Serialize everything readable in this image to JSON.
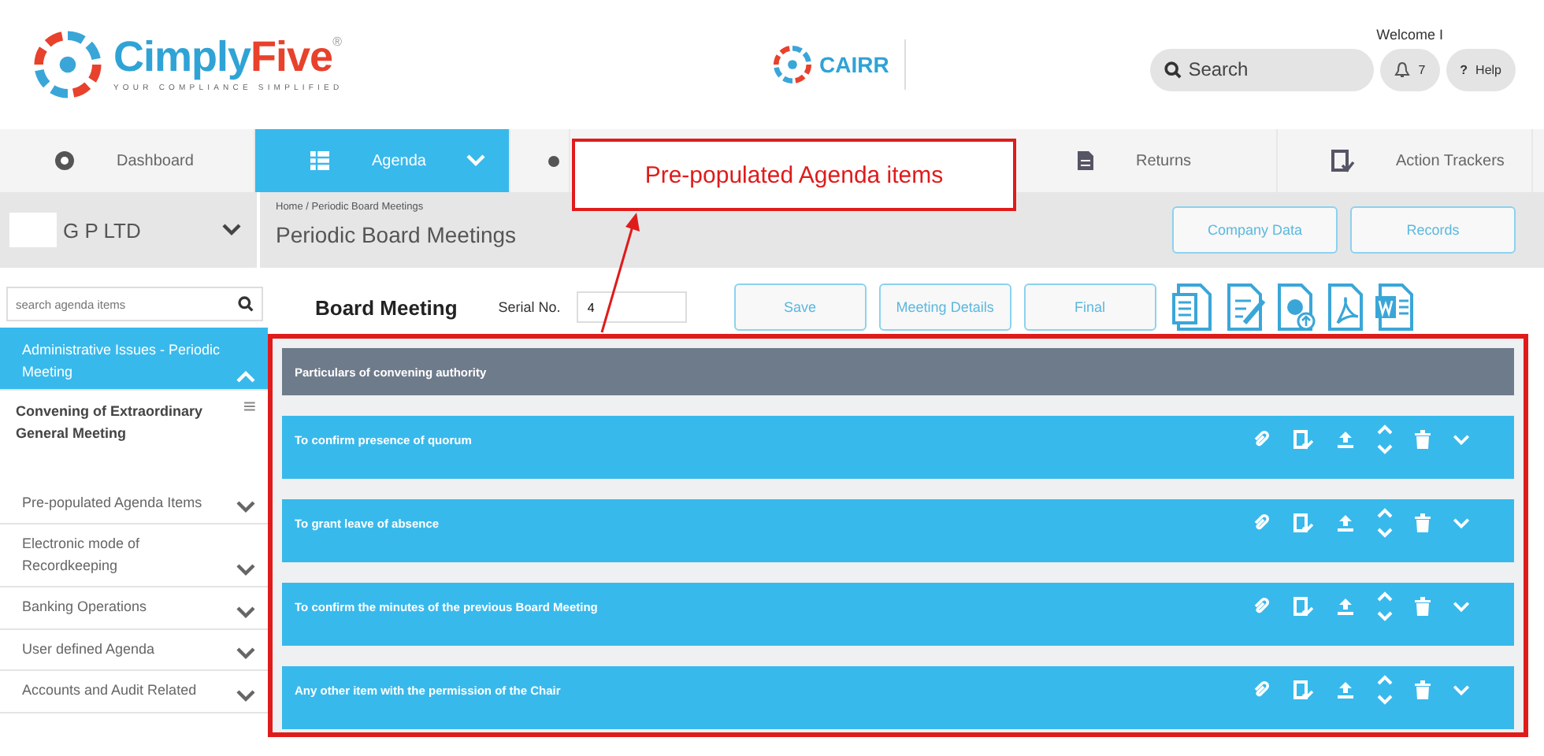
{
  "header": {
    "brand": [
      "Cimply",
      "Five",
      "®"
    ],
    "tagline": "YOUR COMPLIANCE SIMPLIFIED",
    "product": "CAIRR",
    "welcome": "Welcome I",
    "search": {
      "placeholder": "Search"
    },
    "notifications": "7",
    "help_symbol": "?",
    "help": "Help"
  },
  "nav_tabs": [
    {
      "label": "Dashboard",
      "selected": false
    },
    {
      "label": "Agenda",
      "selected": true
    },
    {
      "selected": false
    },
    {
      "label": "Returns",
      "selected": false
    },
    {
      "label": "Action Trackers",
      "selected": false
    }
  ],
  "company": {
    "name": "G P LTD"
  },
  "breadcrumb": "Home / Periodic Board Meetings",
  "page_title": "Periodic Board Meetings",
  "page_buttons": [
    "Company Data",
    "Records"
  ],
  "sidebar": {
    "search": {
      "placeholder": "search agenda items"
    },
    "items": [
      {
        "label": "Administrative Issues - Periodic Meeting",
        "selected": true,
        "expanded": true,
        "children": [
          {
            "label": "Convening of Extraordinary General Meeting"
          }
        ]
      },
      {
        "label": "Pre-populated Agenda Items",
        "selected": false,
        "expanded": false
      },
      {
        "label": "Electronic mode of Recordkeeping",
        "selected": false,
        "expanded": false
      },
      {
        "label": "Banking Operations",
        "selected": false,
        "expanded": false
      },
      {
        "label": "User defined Agenda",
        "selected": false,
        "expanded": false
      },
      {
        "label": "Accounts and Audit Related",
        "selected": false,
        "expanded": false
      }
    ]
  },
  "meeting": {
    "title": "Board Meeting",
    "serial_label": "Serial No.",
    "serial_value": "4",
    "buttons": [
      "Save",
      "Meeting Details",
      "Final"
    ]
  },
  "agenda": [
    {
      "kind": "header",
      "text": "Particulars of convening authority"
    },
    {
      "kind": "item",
      "text": "To confirm presence of quorum"
    },
    {
      "kind": "item",
      "text": "To grant leave of absence"
    },
    {
      "kind": "item",
      "text": "To confirm the minutes of the previous Board Meeting"
    },
    {
      "kind": "item",
      "text": "Any other item with the permission of the Chair"
    }
  ],
  "callout": "Pre-populated Agenda items"
}
